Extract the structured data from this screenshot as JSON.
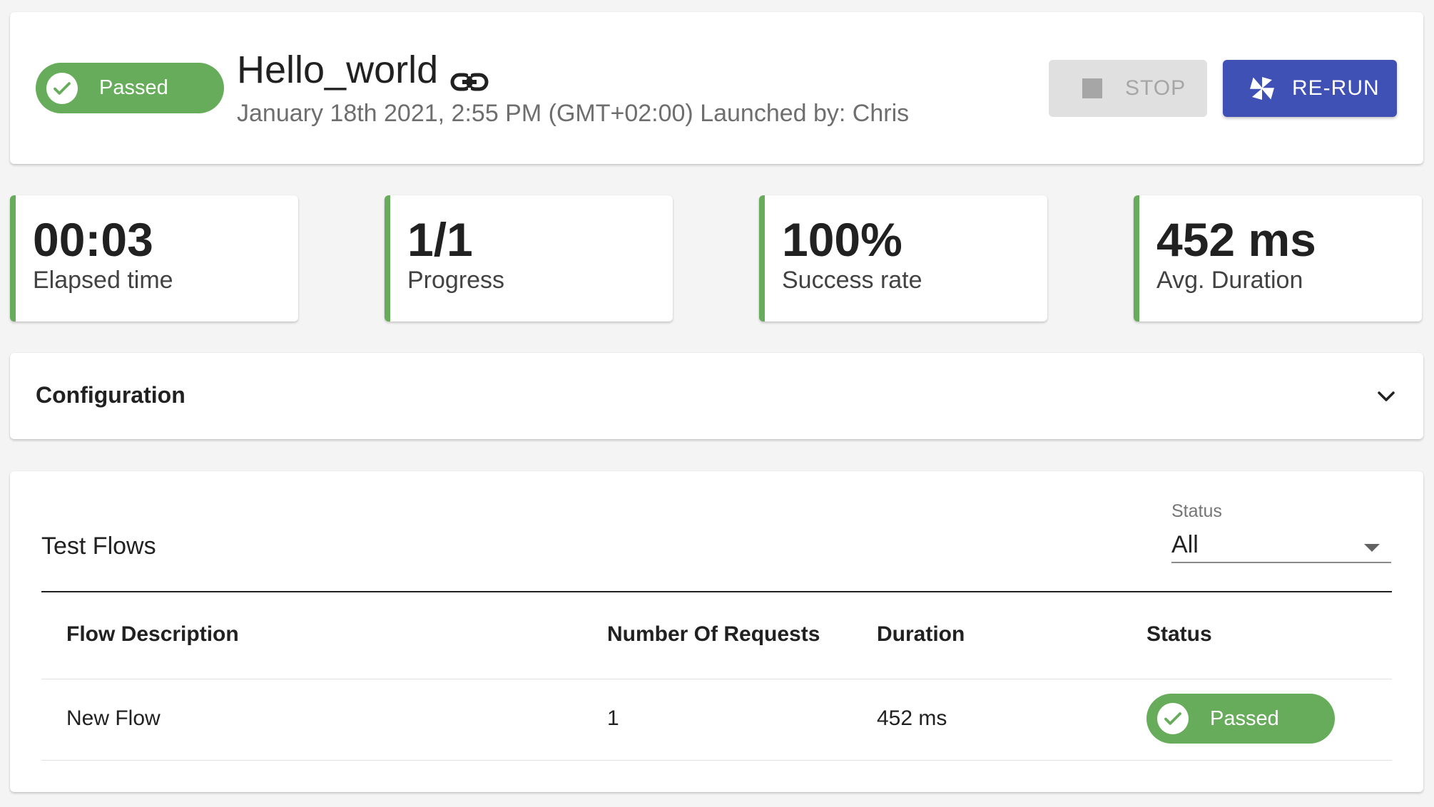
{
  "header": {
    "status": "Passed",
    "title": "Hello_world",
    "meta": "January 18th 2021, 2:55 PM (GMT+02:00) Launched by: Chris",
    "stop_label": "STOP",
    "rerun_label": "RE-RUN"
  },
  "stats": [
    {
      "value": "00:03",
      "label": "Elapsed time"
    },
    {
      "value": "1/1",
      "label": "Progress"
    },
    {
      "value": "100%",
      "label": "Success rate"
    },
    {
      "value": "452 ms",
      "label": "Avg. Duration"
    }
  ],
  "configuration": {
    "title": "Configuration"
  },
  "flows": {
    "title": "Test Flows",
    "filter_label": "Status",
    "filter_value": "All",
    "columns": [
      "Flow Description",
      "Number Of Requests",
      "Duration",
      "Status"
    ],
    "rows": [
      {
        "description": "New Flow",
        "requests": "1",
        "duration": "452 ms",
        "status": "Passed"
      }
    ]
  },
  "colors": {
    "success": "#66ac5b",
    "primary": "#3f51b5",
    "disabled": "#e0e0e0"
  }
}
